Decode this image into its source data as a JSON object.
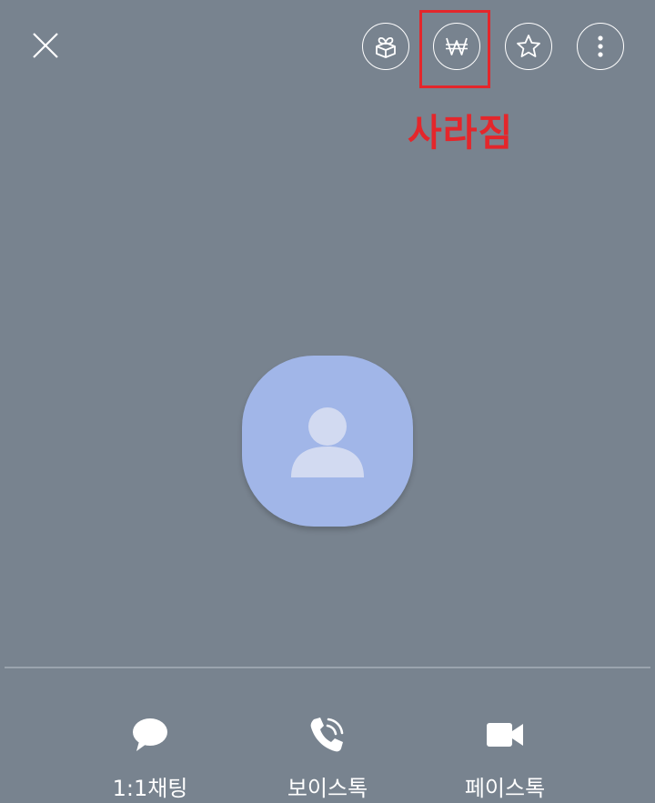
{
  "annotation": {
    "text": "사라짐",
    "color": "#e4262b"
  },
  "colors": {
    "background": "#78838f",
    "avatar": "#a1b6e8",
    "icon": "#ffffff"
  },
  "top_bar": {
    "icons": [
      "close-icon",
      "gift-box-icon",
      "won-currency-icon",
      "star-icon",
      "more-vertical-icon"
    ]
  },
  "actions": [
    {
      "label": "1:1채팅",
      "icon": "chat-bubble-icon"
    },
    {
      "label": "보이스톡",
      "icon": "phone-call-icon"
    },
    {
      "label": "페이스톡",
      "icon": "video-camera-icon"
    }
  ]
}
